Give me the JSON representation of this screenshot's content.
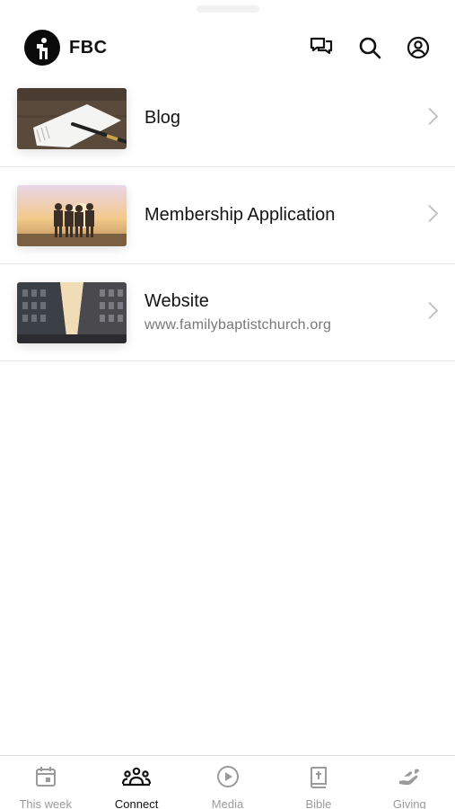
{
  "header": {
    "brand": "FBC"
  },
  "colors": {
    "accent": "#111111",
    "inactive": "#9a9a9a",
    "divider": "#e6e6e6"
  },
  "list": {
    "items": [
      {
        "title": "Blog",
        "subtitle": "",
        "thumbnail": "notebook-pen"
      },
      {
        "title": "Membership Application",
        "subtitle": "",
        "thumbnail": "friends-sunset"
      },
      {
        "title": "Website",
        "subtitle": "www.familybaptistchurch.org",
        "thumbnail": "city-street"
      }
    ]
  },
  "tabs": [
    {
      "label": "This week",
      "icon": "calendar-icon",
      "active": false
    },
    {
      "label": "Connect",
      "icon": "people-icon",
      "active": true
    },
    {
      "label": "Media",
      "icon": "play-icon",
      "active": false
    },
    {
      "label": "Bible",
      "icon": "bible-icon",
      "active": false
    },
    {
      "label": "Giving",
      "icon": "giving-icon",
      "active": false
    }
  ]
}
